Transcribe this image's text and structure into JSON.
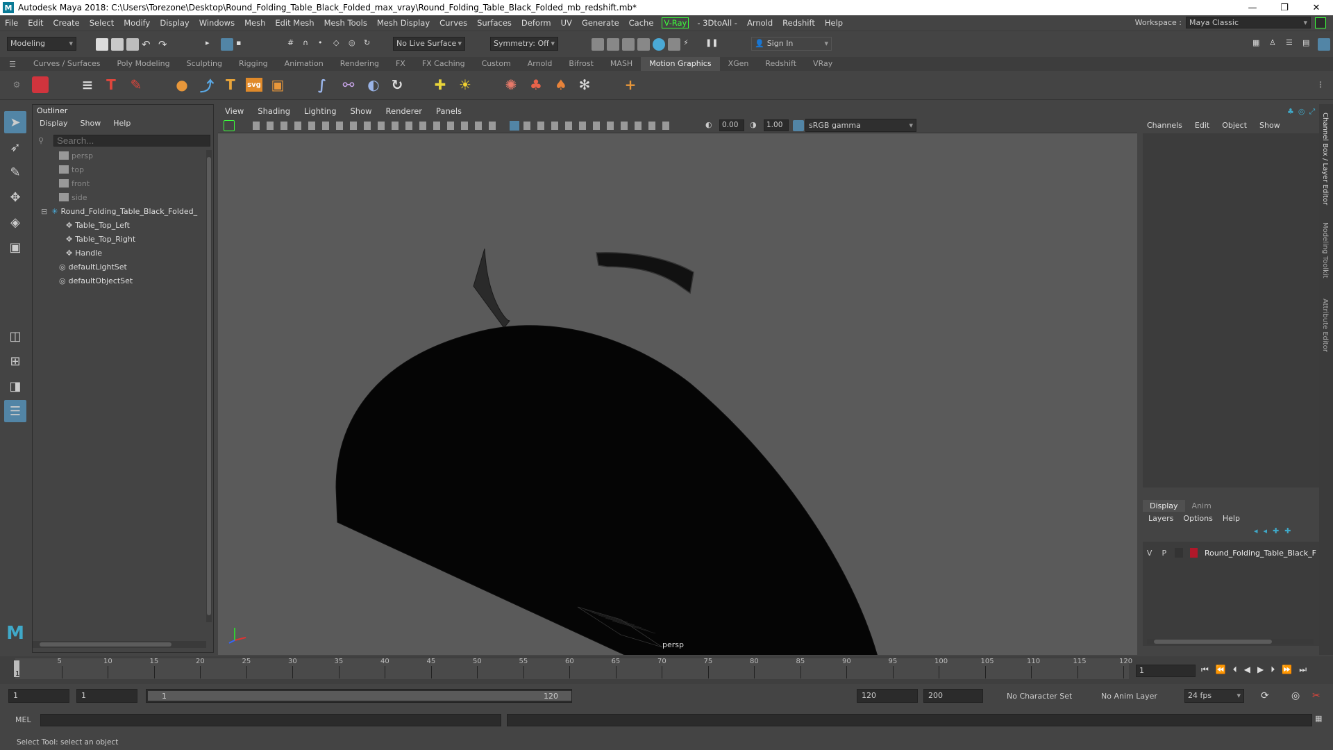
{
  "window": {
    "title": "Autodesk Maya 2018: C:\\Users\\Torezone\\Desktop\\Round_Folding_Table_Black_Folded_max_vray\\Round_Folding_Table_Black_Folded_mb_redshift.mb*",
    "logo": "M",
    "minimize": "—",
    "restore": "❐",
    "close": "✕"
  },
  "menubar": {
    "items": [
      "File",
      "Edit",
      "Create",
      "Select",
      "Modify",
      "Display",
      "Windows",
      "Mesh",
      "Edit Mesh",
      "Mesh Tools",
      "Mesh Display",
      "Curves",
      "Surfaces",
      "Deform",
      "UV",
      "Generate",
      "Cache",
      "V-Ray",
      "- 3DtoAll -",
      "Arnold",
      "Redshift",
      "Help"
    ]
  },
  "workspace": {
    "label": "Workspace :",
    "value": "Maya Classic"
  },
  "statusline": {
    "mode": "Modeling",
    "live_surface": "No Live Surface",
    "symmetry": "Symmetry: Off",
    "sign_in": "Sign In"
  },
  "shelf": {
    "tabs": [
      "Curves / Surfaces",
      "Poly Modeling",
      "Sculpting",
      "Rigging",
      "Animation",
      "Rendering",
      "FX",
      "FX Caching",
      "Custom",
      "Arnold",
      "Bifrost",
      "MASH",
      "Motion Graphics",
      "XGen",
      "Redshift",
      "VRay"
    ],
    "active_tab": "Motion Graphics",
    "icon_texts": [
      "T",
      "T",
      "svg"
    ]
  },
  "outliner": {
    "title": "Outliner",
    "menu": [
      "Display",
      "Show",
      "Help"
    ],
    "search_placeholder": "Search...",
    "items": [
      {
        "label": "persp"
      },
      {
        "label": "top"
      },
      {
        "label": "front"
      },
      {
        "label": "side"
      },
      {
        "label": "Round_Folding_Table_Black_Folded_"
      },
      {
        "label": "Table_Top_Left"
      },
      {
        "label": "Table_Top_Right"
      },
      {
        "label": "Handle"
      },
      {
        "label": "defaultLightSet"
      },
      {
        "label": "defaultObjectSet"
      }
    ]
  },
  "viewport": {
    "menu": [
      "View",
      "Shading",
      "Lighting",
      "Show",
      "Renderer",
      "Panels"
    ],
    "exposure": "0.00",
    "gamma": "1.00",
    "colorspace": "sRGB gamma",
    "camera_label": "persp"
  },
  "channelbox": {
    "menu": [
      "Channels",
      "Edit",
      "Object",
      "Show"
    ],
    "vertical_tabs": [
      "Channel Box / Layer Editor",
      "Modeling Toolkit",
      "Attribute Editor"
    ]
  },
  "layer_editor": {
    "tabs": [
      "Display",
      "Anim"
    ],
    "active_tab": "Display",
    "menu": [
      "Layers",
      "Options",
      "Help"
    ],
    "layer": {
      "v": "V",
      "p": "P",
      "name": "Round_Folding_Table_Black_F",
      "color": "#b0182a"
    }
  },
  "timeline": {
    "ticks": [
      "5",
      "10",
      "15",
      "20",
      "25",
      "30",
      "35",
      "40",
      "45",
      "50",
      "55",
      "60",
      "65",
      "70",
      "75",
      "80",
      "85",
      "90",
      "95",
      "100",
      "105",
      "110",
      "115",
      "120"
    ],
    "current_frame_marker": "1",
    "current_frame": "1"
  },
  "range": {
    "start": "1",
    "playback_start": "1",
    "slider_start": "1",
    "slider_end": "120",
    "playback_end": "120",
    "end": "200",
    "character_set": "No Character Set",
    "anim_layer": "No Anim Layer",
    "fps": "24 fps"
  },
  "mel": {
    "label": "MEL"
  },
  "helpline": {
    "text": "Select Tool: select an object"
  },
  "colors": {
    "accent": "#5285a6",
    "vray_green": "#3cff3c",
    "viewport_bg": "#5a5a5a"
  }
}
